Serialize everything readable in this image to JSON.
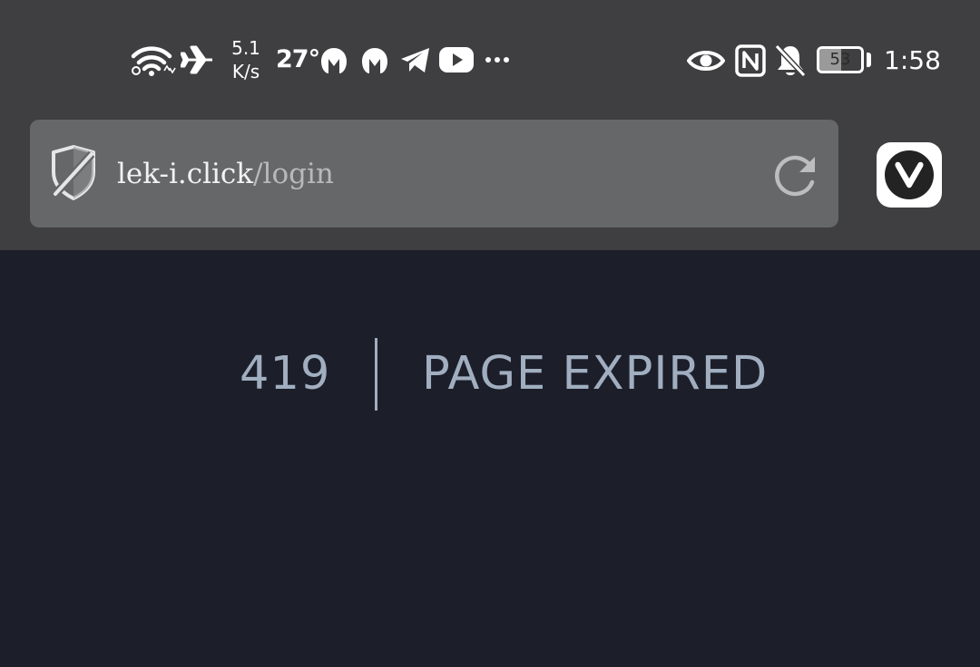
{
  "status_bar": {
    "network_speed_value": "5.1",
    "network_speed_unit": "K/s",
    "temperature": "27°",
    "battery_level": "53",
    "battery_fraction": 0.53,
    "time": "1:58",
    "icons": [
      "wifi-icon",
      "airplane-mode-icon",
      "malwarebytes-icon",
      "malwarebytes-icon",
      "telegram-icon",
      "youtube-icon",
      "more-notifications-icon",
      "eye-comfort-icon",
      "nfc-icon",
      "silent-bell-icon",
      "battery-icon"
    ]
  },
  "browser": {
    "url_host": "lek-i.click",
    "url_path": "/login",
    "icons": [
      "tracker-shield-icon",
      "reload-icon",
      "vivaldi-menu-icon"
    ]
  },
  "error_page": {
    "code": "419",
    "message": "PAGE EXPIRED"
  },
  "colors": {
    "toolbar_background": "#3f3f41",
    "url_bar_background": "#666769",
    "page_background": "#1c1f2a",
    "error_text": "#a0aec0"
  }
}
